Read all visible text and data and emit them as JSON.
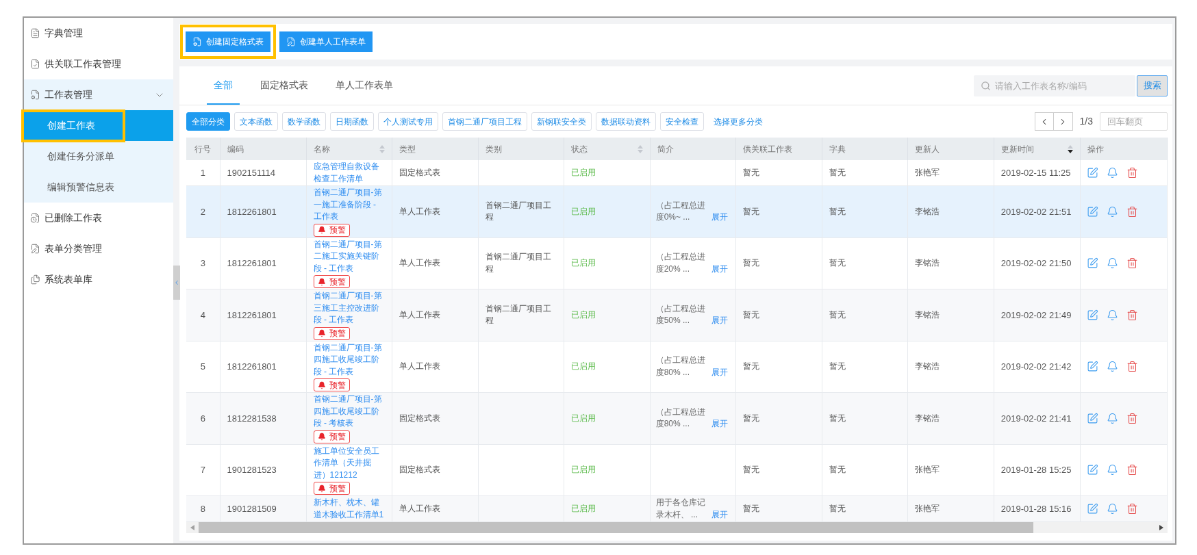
{
  "sidebar": {
    "items": [
      {
        "label": "字典管理"
      },
      {
        "label": "供关联工作表管理"
      },
      {
        "label": "工作表管理",
        "expanded": true,
        "children": [
          {
            "label": "创建工作表",
            "selected": true,
            "highlighted": true
          },
          {
            "label": "创建任务分派单",
            "selected": false,
            "highlighted": false
          },
          {
            "label": "编辑预警信息表",
            "selected": false,
            "highlighted": false
          }
        ]
      },
      {
        "label": "已删除工作表"
      },
      {
        "label": "表单分类管理"
      },
      {
        "label": "系统表单库"
      }
    ]
  },
  "toolbar": {
    "buttons": [
      {
        "label": "创建固定格式表",
        "highlighted": true
      },
      {
        "label": "创建单人工作表单",
        "highlighted": false
      }
    ]
  },
  "tabs": [
    {
      "label": "全部",
      "selected": true
    },
    {
      "label": "固定格式表",
      "selected": false
    },
    {
      "label": "单人工作表单",
      "selected": false
    }
  ],
  "search": {
    "placeholder": "请输入工作表名称/编码",
    "button": "搜索"
  },
  "categories": [
    {
      "label": "全部分类",
      "selected": true
    },
    {
      "label": "文本函数",
      "selected": false
    },
    {
      "label": "数学函数",
      "selected": false
    },
    {
      "label": "日期函数",
      "selected": false
    },
    {
      "label": "个人测试专用",
      "selected": false
    },
    {
      "label": "首钢二通厂项目工程",
      "selected": false
    },
    {
      "label": "新钢联安全类",
      "selected": false
    },
    {
      "label": "数据联动资料",
      "selected": false
    },
    {
      "label": "安全检查",
      "selected": false
    }
  ],
  "more_categories": "选择更多分类",
  "pagination": {
    "page": "1/3",
    "jump_placeholder": "回车翻页"
  },
  "table": {
    "columns": [
      {
        "label": "行号",
        "sortable": false
      },
      {
        "label": "编码",
        "sortable": false
      },
      {
        "label": "名称",
        "sortable": true,
        "sorted_desc": false
      },
      {
        "label": "类型",
        "sortable": false
      },
      {
        "label": "类别",
        "sortable": false
      },
      {
        "label": "状态",
        "sortable": true,
        "sorted_desc": false
      },
      {
        "label": "简介",
        "sortable": false
      },
      {
        "label": "供关联工作表",
        "sortable": false
      },
      {
        "label": "字典",
        "sortable": false
      },
      {
        "label": "更新人",
        "sortable": false
      },
      {
        "label": "更新时间",
        "sortable": true,
        "sorted_desc": true
      },
      {
        "label": "操作",
        "sortable": false
      }
    ],
    "rows": [
      {
        "no": "1",
        "code": "1902151114",
        "name": "应急管理自救设备检查工作清单",
        "type": "固定格式表",
        "status": "已启用",
        "linked_sheet": "暂无",
        "dictionary": "暂无",
        "updater": "张艳军",
        "updated_at": "2019-02-15 11:25",
        "hovered": false
      },
      {
        "no": "2",
        "code": "1812261801",
        "name": "首钢二通厂项目-第一施工准备阶段 - 工作表",
        "warning": "预警",
        "type": "单人工作表",
        "category": "首钢二通厂项目工程",
        "status": "已启用",
        "summary": "（占工程总进度0%~ ...",
        "summary_link": "展开",
        "linked_sheet": "暂无",
        "dictionary": "暂无",
        "updater": "李铭浩",
        "updated_at": "2019-02-02 21:51",
        "hovered": true
      },
      {
        "no": "3",
        "code": "1812261801",
        "name": "首钢二通厂项目-第二施工实施关键阶段 - 工作表",
        "warning": "预警",
        "type": "单人工作表",
        "category": "首钢二通厂项目工程",
        "status": "已启用",
        "summary": "（占工程总进度20% ...",
        "summary_link": "展开",
        "linked_sheet": "暂无",
        "dictionary": "暂无",
        "updater": "李铭浩",
        "updated_at": "2019-02-02 21:50",
        "hovered": false
      },
      {
        "no": "4",
        "code": "1812261801",
        "name": "首钢二通厂项目-第三施工主控改进阶段 - 工作表",
        "warning": "预警",
        "type": "单人工作表",
        "category": "首钢二通厂项目工程",
        "status": "已启用",
        "summary": "（占工程总进度50% ...",
        "summary_link": "展开",
        "linked_sheet": "暂无",
        "dictionary": "暂无",
        "updater": "李铭浩",
        "updated_at": "2019-02-02 21:49",
        "hovered": false
      },
      {
        "no": "5",
        "code": "1812261801",
        "name": "首钢二通厂项目-第四施工收尾竣工阶段 - 工作表",
        "warning": "预警",
        "type": "单人工作表",
        "status": "已启用",
        "summary": "（占工程总进度80% ...",
        "summary_link": "展开",
        "linked_sheet": "暂无",
        "dictionary": "暂无",
        "updater": "李铭浩",
        "updated_at": "2019-02-02 21:42",
        "hovered": false
      },
      {
        "no": "6",
        "code": "1812281538",
        "name": "首钢二通厂项目-第四施工收尾竣工阶段 - 考核表",
        "warning": "预警",
        "type": "固定格式表",
        "status": "已启用",
        "summary": "（占工程总进度80% ...",
        "summary_link": "展开",
        "linked_sheet": "暂无",
        "dictionary": "暂无",
        "updater": "李铭浩",
        "updated_at": "2019-02-02 21:41",
        "hovered": false
      },
      {
        "no": "7",
        "code": "1901281523",
        "name": "施工单位安全员工作清单（天井掘进）121212",
        "warning": "预警",
        "type": "固定格式表",
        "status": "已启用",
        "linked_sheet": "暂无",
        "dictionary": "暂无",
        "updater": "张艳军",
        "updated_at": "2019-01-28 15:25",
        "hovered": false
      },
      {
        "no": "8",
        "code": "1901281509",
        "name": "新木杆、枕木、罐道木验收工作清单1",
        "type": "单人工作表",
        "status": "已启用",
        "summary": "用于各仓库记录木杆、 ...",
        "summary_link": "展开",
        "linked_sheet": "暂无",
        "dictionary": "暂无",
        "updater": "张艳军",
        "updated_at": "2019-01-28 15:16",
        "hovered": false
      }
    ]
  }
}
